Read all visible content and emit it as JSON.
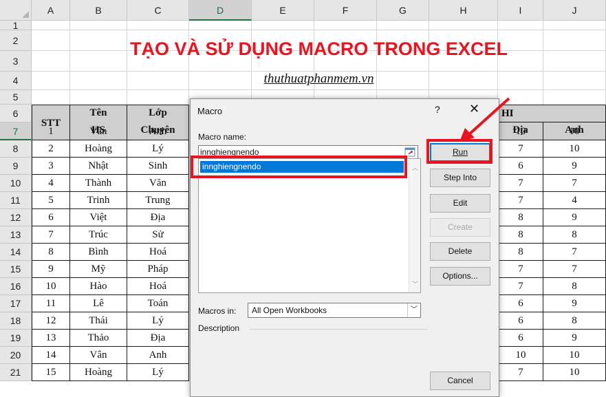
{
  "sheet": {
    "columns": [
      "A",
      "B",
      "C",
      "D",
      "E",
      "F",
      "G",
      "H",
      "I",
      "J"
    ],
    "selected_column": "D",
    "rows": [
      "1",
      "2",
      "3",
      "4",
      "5",
      "6",
      "7",
      "8",
      "9",
      "10",
      "11",
      "12",
      "13",
      "14",
      "15",
      "16",
      "17",
      "18",
      "19",
      "20",
      "21"
    ],
    "selected_row": "7",
    "title": "TẠO VÀ SỬ DỤNG MACRO TRONG EXCEL",
    "subtitle": "thuthuatphanmem.vn",
    "headers": {
      "stt": "STT",
      "ten": "Tên",
      "hs": "HS",
      "lop": "Lớp",
      "chuyen": "Chuyên",
      "group": "HI",
      "dia": "Địa",
      "anh": "Anh"
    },
    "table": [
      [
        "1",
        "Vân",
        "Anh",
        "10",
        "10"
      ],
      [
        "2",
        "Hoàng",
        "Lý",
        "7",
        "10"
      ],
      [
        "3",
        "Nhật",
        "Sinh",
        "6",
        "9"
      ],
      [
        "4",
        "Thành",
        "Văn",
        "7",
        "7"
      ],
      [
        "5",
        "Trinh",
        "Trung",
        "7",
        "4"
      ],
      [
        "6",
        "Việt",
        "Địa",
        "8",
        "9"
      ],
      [
        "7",
        "Trúc",
        "Sử",
        "8",
        "8"
      ],
      [
        "8",
        "Bình",
        "Hoá",
        "8",
        "7"
      ],
      [
        "9",
        "Mỹ",
        "Pháp",
        "7",
        "7"
      ],
      [
        "10",
        "Hào",
        "Hoá",
        "7",
        "8"
      ],
      [
        "11",
        "Lê",
        "Toán",
        "6",
        "9"
      ],
      [
        "12",
        "Thái",
        "Lý",
        "6",
        "8"
      ],
      [
        "13",
        "Thảo",
        "Địa",
        "6",
        "9"
      ],
      [
        "14",
        "Vân",
        "Anh",
        "10",
        "10"
      ],
      [
        "15",
        "Hoàng",
        "Lý",
        "7",
        "10"
      ]
    ]
  },
  "dialog": {
    "title": "Macro",
    "help": "?",
    "close": "✕",
    "macro_name_label": "Macro name:",
    "macro_name_value": "innghiengnendo",
    "list_items": [
      "innghiengnendo"
    ],
    "buttons": {
      "run": "Run",
      "step_into": "Step Into",
      "edit": "Edit",
      "create": "Create",
      "delete": "Delete",
      "options": "Options...",
      "cancel": "Cancel"
    },
    "macros_in_label": "Macros in:",
    "macros_in_value": "All Open Workbooks",
    "description_label": "Description"
  },
  "annotation_color": "#e8141f"
}
